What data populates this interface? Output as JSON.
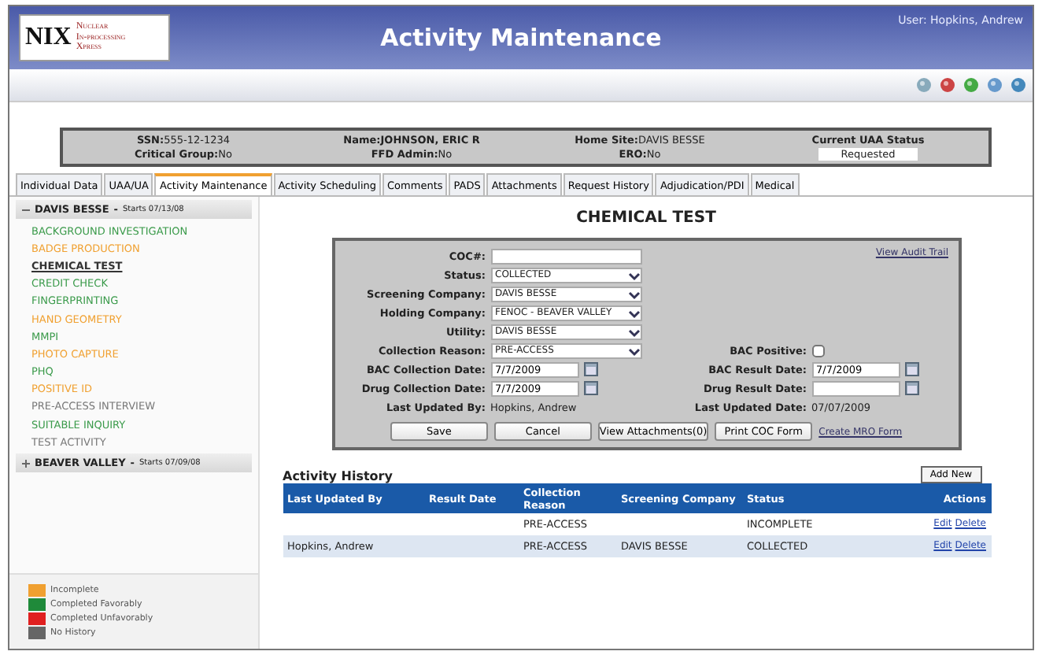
{
  "header": {
    "logo": {
      "mark": "NIX",
      "lines": [
        "Nuclear",
        "In-processing",
        "Xpress"
      ]
    },
    "title": "Activity Maintenance",
    "user": "User: Hopkins, Andrew"
  },
  "info": {
    "rows": [
      [
        {
          "label": "SSN:",
          "value": "555-12-1234",
          "bold": false
        },
        {
          "label": "Name:",
          "value": "JOHNSON, ERIC R",
          "bold": true
        },
        {
          "label": "Home Site:",
          "value": "DAVIS BESSE",
          "bold": false
        }
      ],
      [
        {
          "label": "Critical Group:",
          "value": "No",
          "bold": false
        },
        {
          "label": "FFD Admin:",
          "value": "No",
          "bold": false
        },
        {
          "label": "ERO:",
          "value": "No",
          "bold": false
        }
      ]
    ],
    "status": {
      "label": "Current UAA Status",
      "value": "Requested"
    }
  },
  "tabs": [
    {
      "label": "Individual Data",
      "selected": false
    },
    {
      "label": "UAA/UA",
      "selected": false
    },
    {
      "label": "Activity Maintenance",
      "selected": true
    },
    {
      "label": "Activity Scheduling",
      "selected": false
    },
    {
      "label": "Comments",
      "selected": false
    },
    {
      "label": "PADS",
      "selected": false
    },
    {
      "label": "Attachments",
      "selected": false
    },
    {
      "label": "Request History",
      "selected": false
    },
    {
      "label": "Adjudication/PDI",
      "selected": false
    },
    {
      "label": "Medical",
      "selected": false
    }
  ],
  "sidebar": {
    "groups": [
      {
        "name": "DAVIS BESSE",
        "separator": "-",
        "date": "Starts 07/13/08",
        "expanded": true,
        "children": [
          {
            "label": "BACKGROUND INVESTIGATION",
            "color": "#3a9a4a",
            "selected": false
          },
          {
            "label": "BADGE PRODUCTION",
            "color": "#f0a030",
            "selected": false
          },
          {
            "label": "CHEMICAL TEST",
            "color": "#333333",
            "selected": true
          },
          {
            "label": "CREDIT CHECK",
            "color": "#3a9a4a",
            "selected": false
          },
          {
            "label": "FINGERPRINTING",
            "color": "#3a9a4a",
            "selected": false
          },
          {
            "label": "HAND GEOMETRY",
            "color": "#f0a030",
            "selected": false
          },
          {
            "label": "MMPI",
            "color": "#3a9a4a",
            "selected": false
          },
          {
            "label": "PHOTO CAPTURE",
            "color": "#f0a030",
            "selected": false
          },
          {
            "label": "PHQ",
            "color": "#3a9a4a",
            "selected": false
          },
          {
            "label": "POSITIVE ID",
            "color": "#f0a030",
            "selected": false
          },
          {
            "label": "PRE-ACCESS INTERVIEW",
            "color": "#777777",
            "selected": false
          },
          {
            "label": "SUITABLE INQUIRY",
            "color": "#3a9a4a",
            "selected": false
          },
          {
            "label": "TEST ACTIVITY",
            "color": "#777777",
            "selected": false
          }
        ]
      },
      {
        "name": "BEAVER VALLEY",
        "separator": "-",
        "date": "Starts 07/09/08",
        "expanded": false
      }
    ],
    "legend": [
      {
        "label": "Incomplete",
        "color": "#f0a030"
      },
      {
        "label": "Completed Favorably",
        "color": "#1f8a3a"
      },
      {
        "label": "Completed Unfavorably",
        "color": "#e02020"
      },
      {
        "label": "No History",
        "color": "#666666"
      }
    ]
  },
  "form": {
    "title": "CHEMICAL TEST",
    "audit_link": "View Audit Trail",
    "rows": [
      [
        {
          "label": "COC#:",
          "kind": "text"
        }
      ],
      [
        {
          "label": "Status:",
          "kind": "select",
          "value": "COLLECTED"
        }
      ],
      [
        {
          "label": "Screening Company:",
          "kind": "select",
          "value": "DAVIS BESSE"
        }
      ],
      [
        {
          "label": "Holding Company:",
          "kind": "select",
          "value": "FENOC - BEAVER VALLEY"
        }
      ],
      [
        {
          "label": "Utility:",
          "kind": "select",
          "value": "DAVIS BESSE"
        }
      ],
      [
        {
          "label": "Collection Reason:",
          "kind": "select",
          "value": "PRE-ACCESS"
        },
        {
          "label": "BAC Positive:",
          "kind": "checkbox",
          "checked": false
        }
      ],
      [
        {
          "label": "BAC Collection Date:",
          "kind": "date",
          "value": "7/7/2009"
        },
        {
          "label": "BAC Result Date:",
          "kind": "date",
          "value": "7/7/2009"
        }
      ],
      [
        {
          "label": "Drug Collection Date:",
          "kind": "date",
          "value": "7/7/2009"
        },
        {
          "label": "Drug Result Date:",
          "kind": "date"
        }
      ],
      [
        {
          "label": "Last Updated By:",
          "kind": "readonly",
          "value": "Hopkins, Andrew"
        },
        {
          "label": "Last Updated Date:",
          "kind": "readonly",
          "value": "07/07/2009"
        }
      ]
    ],
    "buttons": [
      "Save",
      "Cancel",
      "View Attachments(0)",
      "Print COC Form"
    ],
    "mro_link": "Create MRO Form"
  },
  "history": {
    "title": "Activity History",
    "add_button": "Add New",
    "columns": [
      "Last Updated By",
      "Result Date",
      "Collection Reason",
      "Screening Company",
      "Status",
      "Actions"
    ],
    "rows": [
      {
        "cells": [
          "",
          "",
          "PRE-ACCESS",
          "",
          "INCOMPLETE"
        ],
        "actions": [
          "Edit",
          "Delete"
        ]
      },
      {
        "cells": [
          "Hopkins, Andrew",
          "",
          "PRE-ACCESS",
          "DAVIS BESSE",
          "COLLECTED"
        ],
        "actions": [
          "Edit",
          "Delete"
        ]
      }
    ]
  }
}
